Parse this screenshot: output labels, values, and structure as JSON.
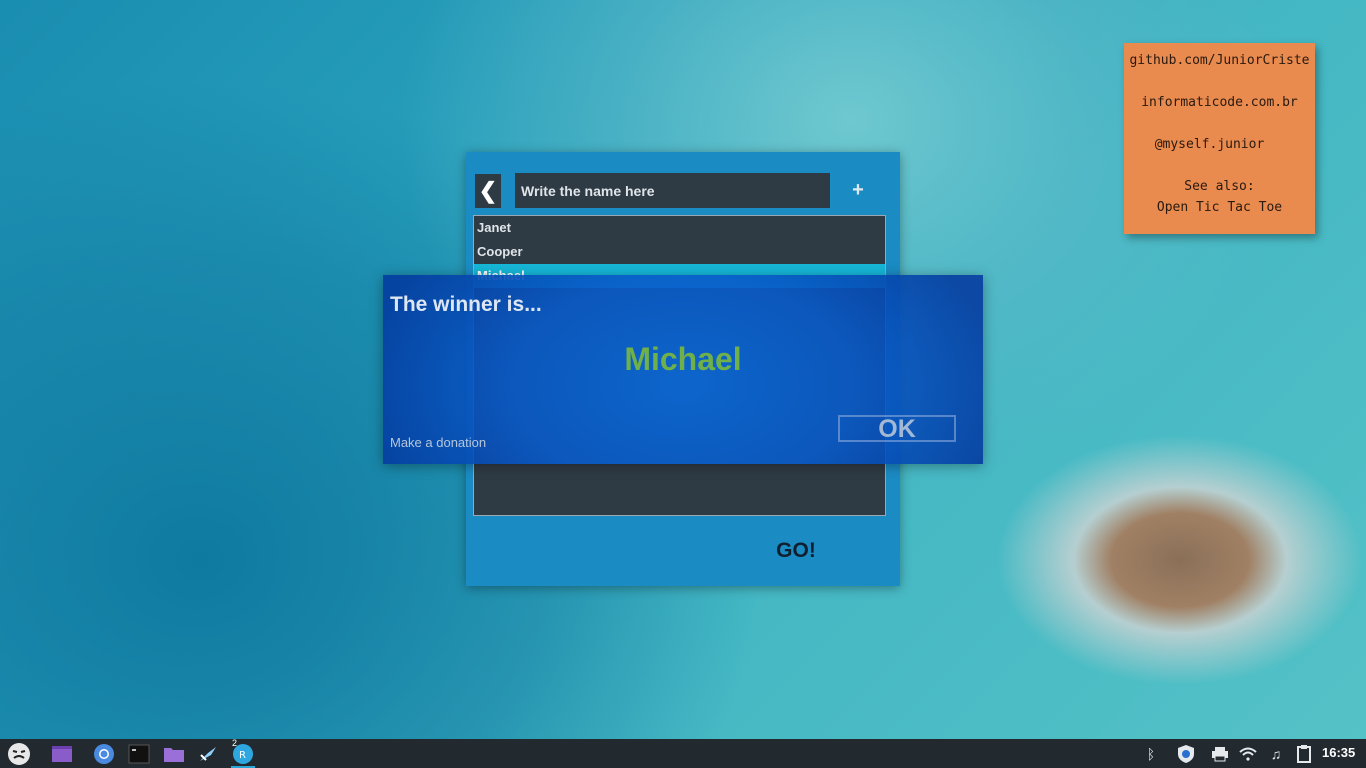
{
  "sticky_note": {
    "lines": [
      "github.com/JuniorCriste",
      "informaticode.com.br",
      "@myself.junior",
      "See also:",
      "Open Tic Tac Toe"
    ]
  },
  "app": {
    "back_label": "❮",
    "name_input_placeholder": "Write the name here",
    "add_label": "+",
    "names": [
      "Janet",
      "Cooper",
      "Michael"
    ],
    "selected_index": 2,
    "go_label": "GO!"
  },
  "dialog": {
    "title": "The winner is...",
    "winner": "Michael",
    "donation_link": "Make a donation",
    "ok_label": "OK"
  },
  "taskbar": {
    "workspace_badge": "2",
    "clock": "16:35"
  },
  "colors": {
    "app_background": "#1b8bc4",
    "list_background": "#2f3b44",
    "selected_item": "#16b7d8",
    "winner_text": "#6fb04a",
    "sticky_note": "#e98a4e",
    "taskbar": "#222a30"
  }
}
